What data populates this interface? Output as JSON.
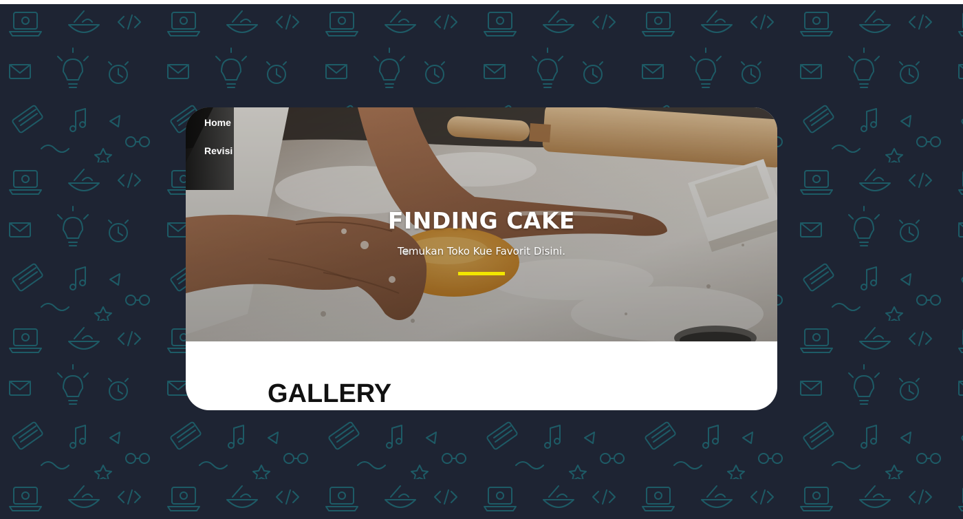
{
  "nav": {
    "items": [
      {
        "label": "Home"
      },
      {
        "label": "Revisi"
      }
    ]
  },
  "hero": {
    "title": "FINDING CAKE",
    "subtitle": "Temukan Toko Kue Favorit Disini.",
    "accent_color": "#f2e600",
    "image": "baking-dough-photo"
  },
  "section": {
    "title": "GALLERY"
  },
  "colors": {
    "background": "#1e2433",
    "doodle": "#1d5b66",
    "card": "#ffffff",
    "accent": "#f2e600"
  }
}
